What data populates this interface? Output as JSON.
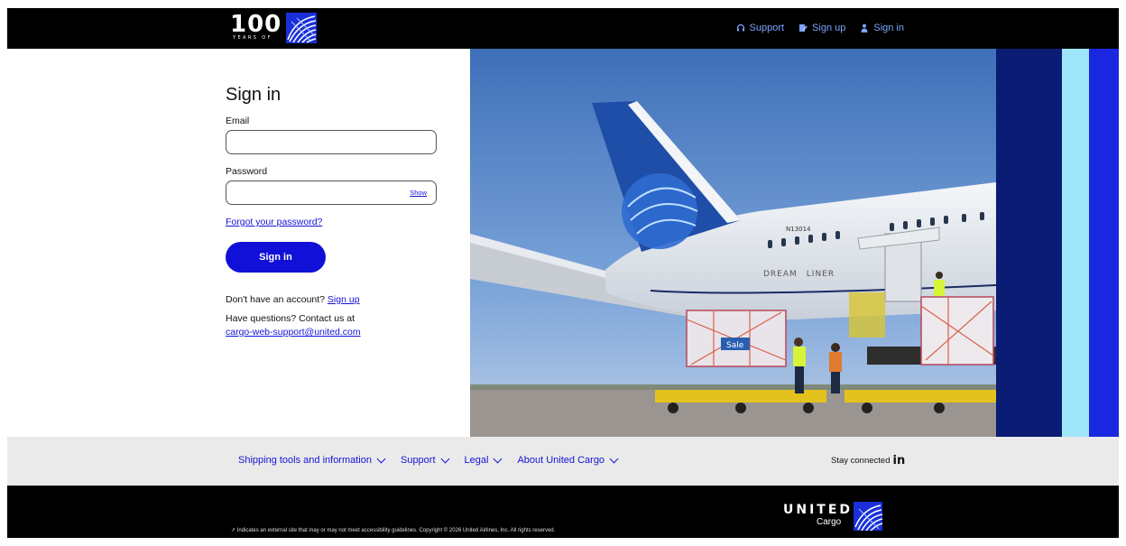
{
  "header": {
    "logo_number": "100",
    "logo_tagline": "YEARS OF",
    "nav": [
      {
        "label": "Support",
        "icon": "headset-icon"
      },
      {
        "label": "Sign up",
        "icon": "signup-icon"
      },
      {
        "label": "Sign in",
        "icon": "person-icon"
      }
    ]
  },
  "form": {
    "title": "Sign in",
    "email_label": "Email",
    "email_value": "",
    "password_label": "Password",
    "password_value": "",
    "show_label": "Show",
    "forgot_label": "Forgot your password?",
    "submit_label": "Sign in",
    "no_account_text": "Don't have an account?",
    "signup_link": "Sign up",
    "questions_text": "Have questions? Contact us at",
    "support_email": "cargo-web-support@united.com"
  },
  "hero": {
    "registration": "N13014",
    "aircraft_label": "DREAM",
    "aircraft_label_2": "LINER",
    "container_label": "Sale"
  },
  "footer_nav": {
    "items": [
      {
        "label": "Shipping tools and information"
      },
      {
        "label": "Support"
      },
      {
        "label": "Legal"
      },
      {
        "label": "About United Cargo"
      }
    ],
    "stay_connected": "Stay connected",
    "linkedin": "in"
  },
  "bottom": {
    "copyright": "↗ Indicates an external site that may or may not meet accessibility guidelines. Copyright © 2026 United Airlines, Inc. All rights reserved.",
    "brand": "UNITED",
    "brand_sub": "Cargo"
  },
  "colors": {
    "accent": "#1010d8",
    "link": "#1414d6",
    "navy": "#0a1c73",
    "light_blue": "#9fe6fb",
    "blue": "#1a27e0"
  }
}
